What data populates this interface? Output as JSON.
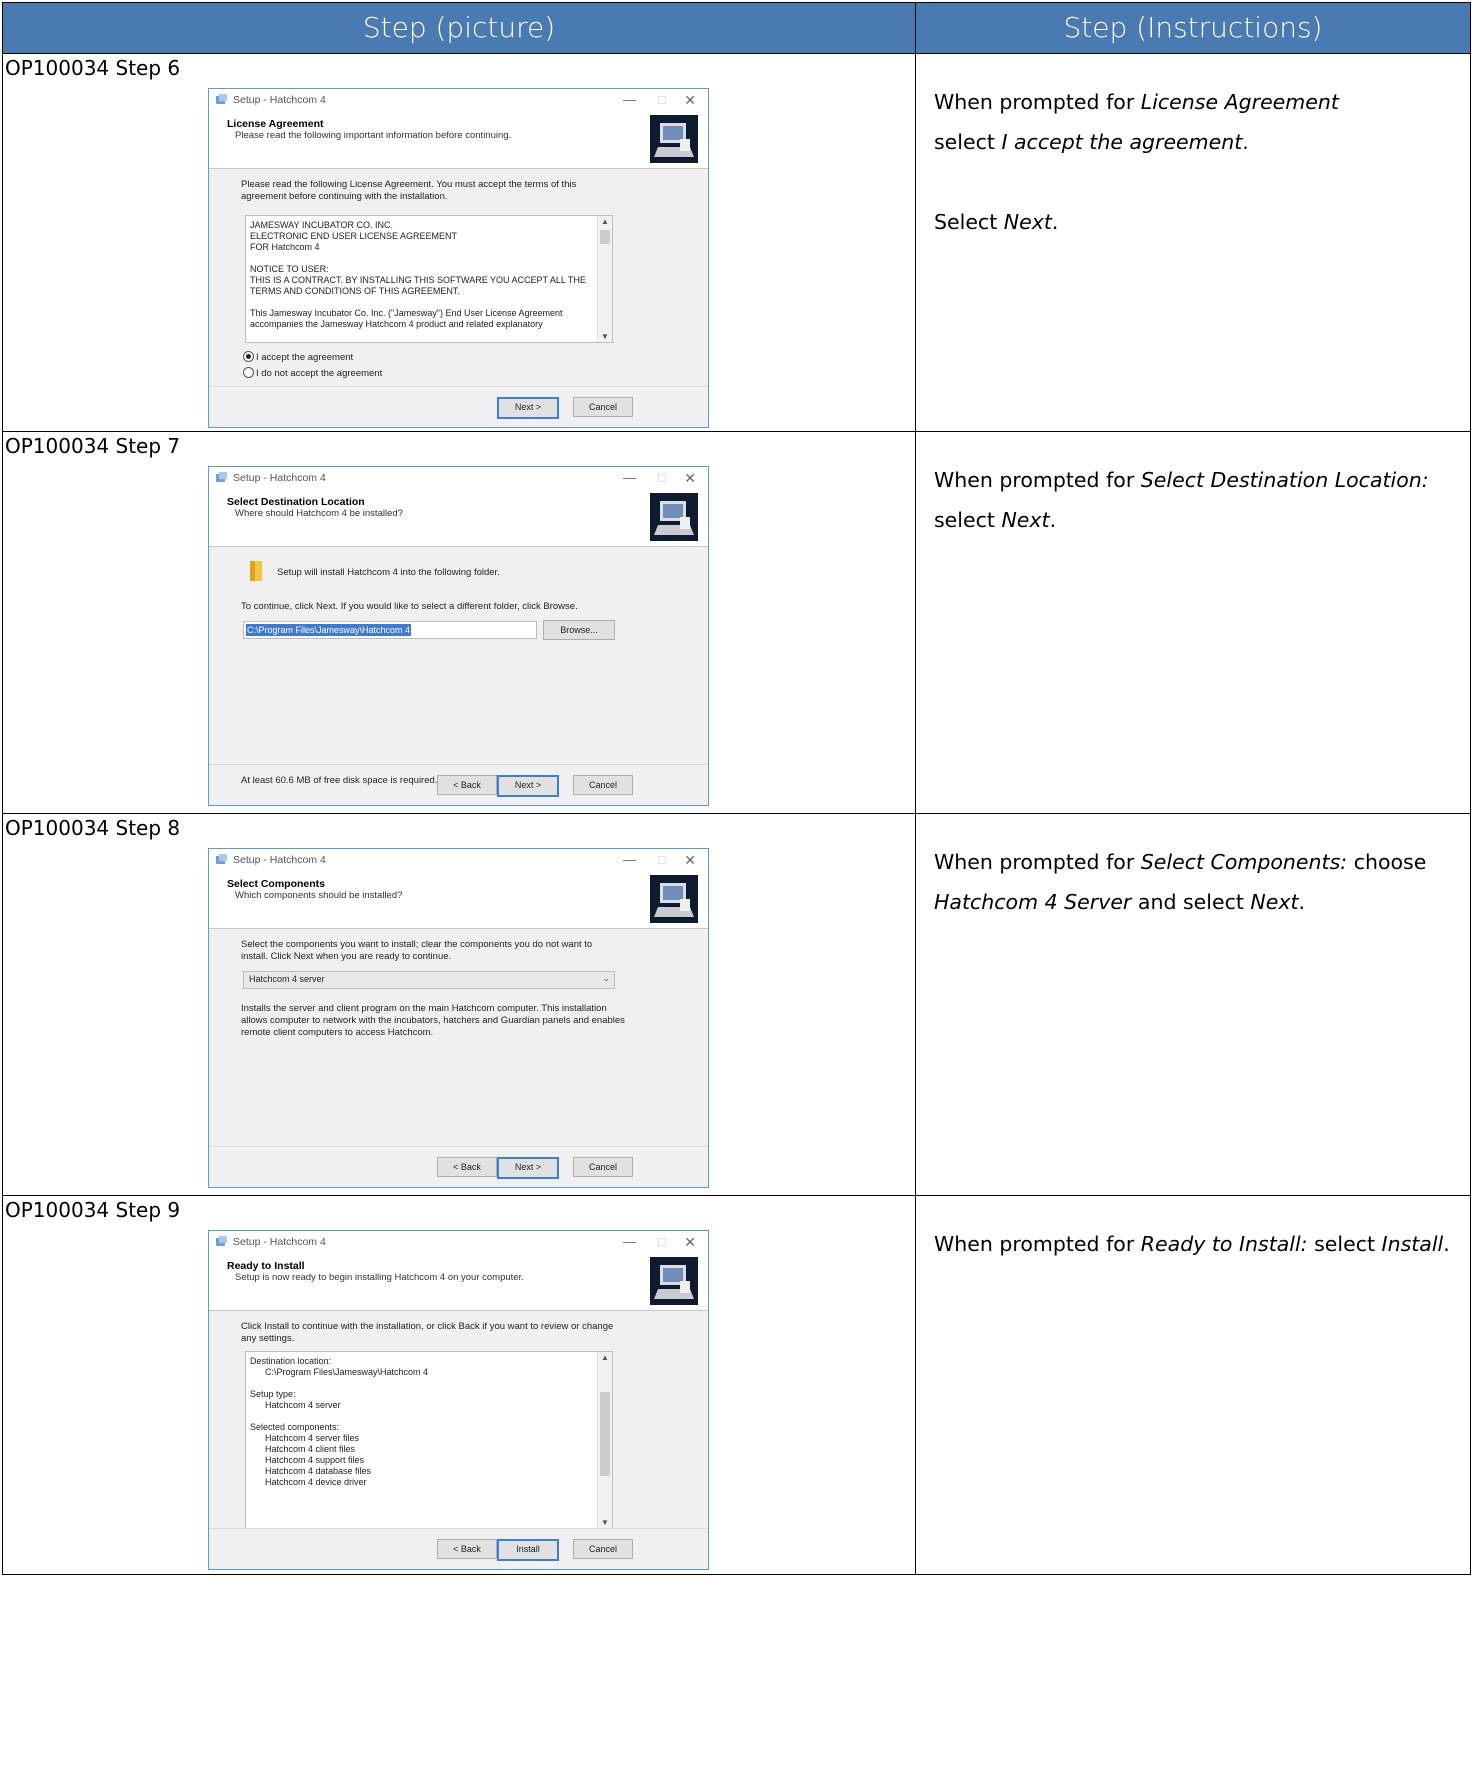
{
  "header": {
    "col1": "Step (picture)",
    "col2": "Step (Instructions)"
  },
  "window_title": "Setup - Hatchcom 4",
  "buttons": {
    "back": "< Back",
    "next": "Next >",
    "cancel": "Cancel",
    "install": "Install",
    "browse": "Browse..."
  },
  "steps": [
    {
      "label": "OP100034 Step 6",
      "banner_title": "License Agreement",
      "banner_subtitle": "Please read the following important information before continuing.",
      "intro": "Please read the following License Agreement. You must accept the terms of this agreement before continuing with the installation.",
      "license_text": "JAMESWAY INCUBATOR CO. INC.\nELECTRONIC END USER LICENSE AGREEMENT\nFOR Hatchcom 4\n\nNOTICE TO USER:\nTHIS IS A CONTRACT. BY INSTALLING THIS SOFTWARE YOU ACCEPT ALL THE\nTERMS AND CONDITIONS OF THIS AGREEMENT.\n\nThis Jamesway Incubator Co. Inc. (\"Jamesway\") End User License Agreement\naccompanies the Jamesway Hatchcom 4 product and related explanatory",
      "radio_accept": "I accept the agreement",
      "radio_decline": "I do not accept the agreement",
      "instructions": [
        [
          "When prompted for ",
          "License Agreement",
          " select ",
          "I accept the agreement",
          "."
        ],
        [
          "Select ",
          "Next",
          "."
        ]
      ]
    },
    {
      "label": "OP100034 Step 7",
      "banner_title": "Select Destination Location",
      "banner_subtitle": "Where should Hatchcom 4 be installed?",
      "line1": "Setup will install Hatchcom 4 into the following folder.",
      "line2": "To continue, click Next. If you would like to select a different folder, click Browse.",
      "path": "C:\\Program Files\\Jamesway\\Hatchcom 4",
      "space": "At least 60.6 MB of free disk space is required.",
      "instructions": "When prompted for <i>Select Destination Location:</i> select <i>Next</i>."
    },
    {
      "label": "OP100034 Step 8",
      "banner_title": "Select Components",
      "banner_subtitle": "Which components should be installed?",
      "intro": "Select the components you want to install; clear the components you do not want to install. Click Next when you are ready to continue.",
      "select_value": "Hatchcom 4 server",
      "description": "Installs the server and client program on the main Hatchcom computer. This installation allows computer to network with the incubators, hatchers and Guardian panels and enables remote client computers to access Hatchcom.",
      "instructions": "When prompted for <i>Select Components:</i> choose <i>Hatchcom 4 Server</i> and select <i>Next</i>."
    },
    {
      "label": "OP100034 Step 9",
      "banner_title": "Ready to Install",
      "banner_subtitle": "Setup is now ready to begin installing Hatchcom 4 on your computer.",
      "intro": "Click Install to continue with the installation, or click Back if you want to review or change any settings.",
      "summary_text": "Destination location:\n      C:\\Program Files\\Jamesway\\Hatchcom 4\n\nSetup type:\n      Hatchcom 4 server\n\nSelected components:\n      Hatchcom 4 server files\n      Hatchcom 4 client files\n      Hatchcom 4 support files\n      Hatchcom 4 database files\n      Hatchcom 4 device driver",
      "instructions": "When prompted for <i>Ready to Install:</i> select <i>Install</i>."
    }
  ]
}
